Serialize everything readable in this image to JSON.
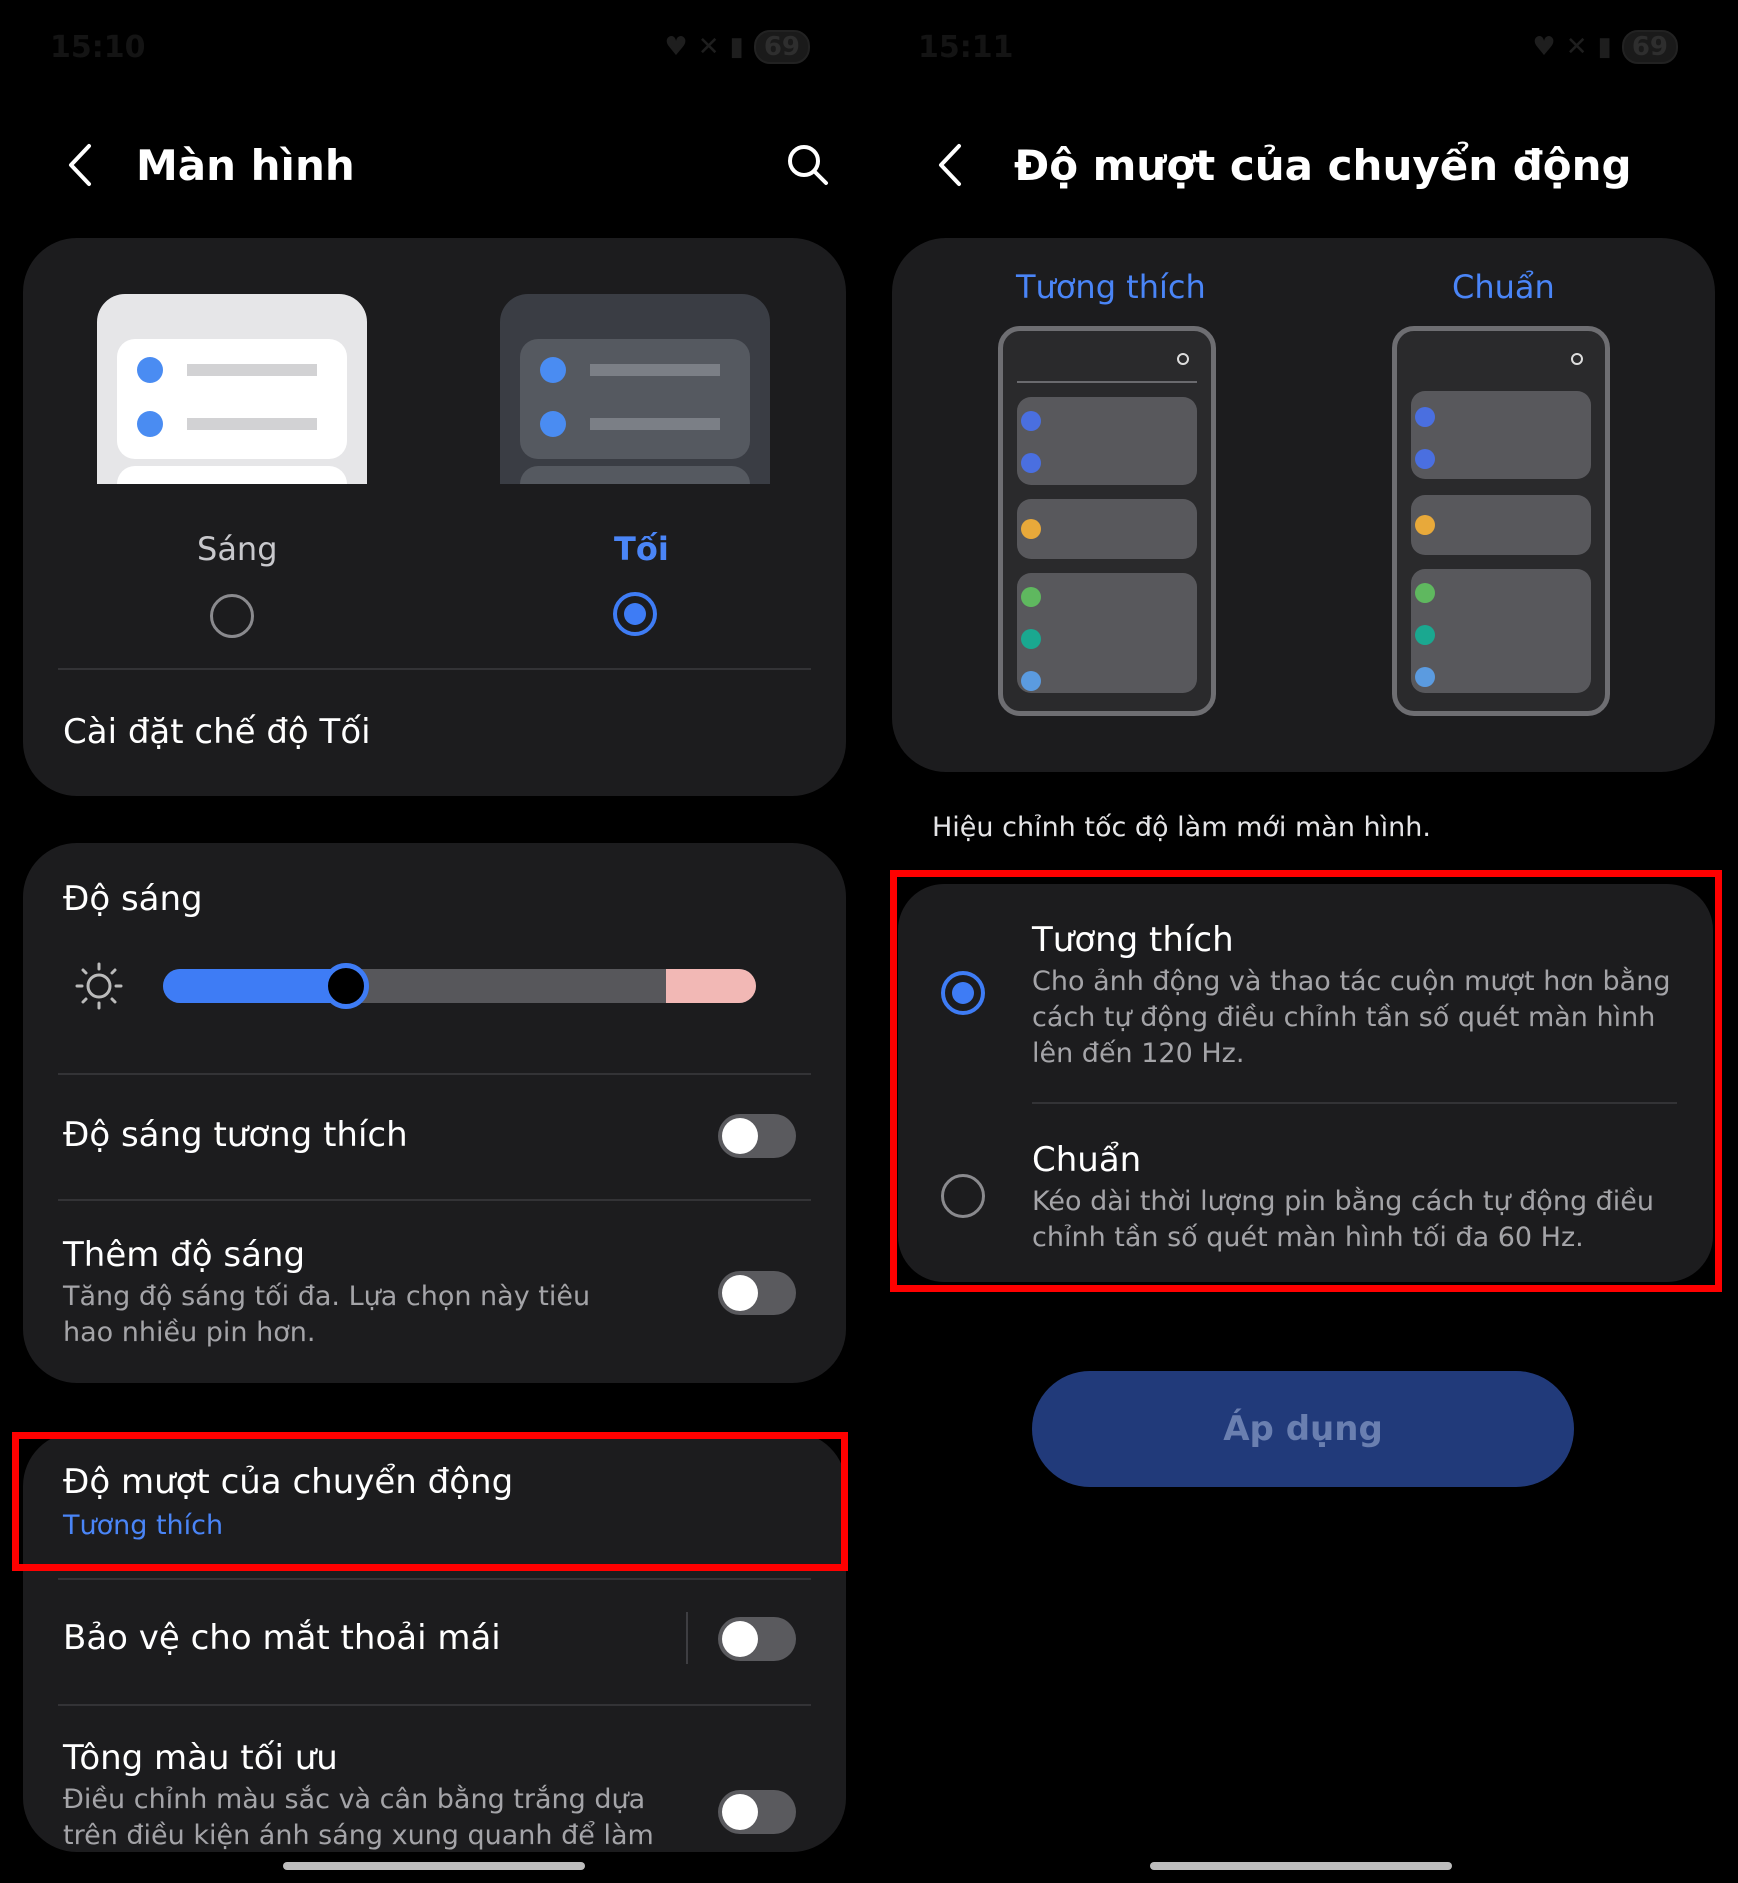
{
  "left": {
    "status": {
      "time": "15:10",
      "battery": "69"
    },
    "header": {
      "title": "Màn hình"
    },
    "theme": {
      "light_label": "Sáng",
      "dark_label": "Tối",
      "dark_mode_settings": "Cài đặt chế độ Tối"
    },
    "brightness": {
      "title": "Độ sáng",
      "level": 0.3,
      "adaptive_label": "Độ sáng tương thích",
      "extra_label": "Thêm độ sáng",
      "extra_sub": "Tăng độ sáng tối đa. Lựa chọn này tiêu hao nhiều pin hơn."
    },
    "motion": {
      "title": "Độ mượt của chuyển động",
      "value": "Tương thích"
    },
    "eye_comfort": {
      "title": "Bảo vệ cho mắt thoải mái"
    },
    "optimal_tone": {
      "title": "Tông màu tối ưu",
      "sub": "Điều chỉnh màu sắc và cân bằng trắng dựa trên điều kiện ánh sáng xung quanh để làm cho màu sắc"
    }
  },
  "right": {
    "status": {
      "time": "15:11",
      "battery": "69"
    },
    "header": {
      "title": "Độ mượt của chuyển động"
    },
    "preview": {
      "adaptive_label": "Tương thích",
      "standard_label": "Chuẩn"
    },
    "caption": "Hiệu chỉnh tốc độ làm mới màn hình.",
    "options": [
      {
        "title": "Tương thích",
        "desc": "Cho ảnh động và thao tác cuộn mượt hơn bằng cách tự động điều chỉnh tần số quét màn hình lên đến 120 Hz.",
        "selected": true
      },
      {
        "title": "Chuẩn",
        "desc": "Kéo dài thời lượng pin bằng cách tự động điều chỉnh tần số quét màn hình tối đa 60 Hz.",
        "selected": false
      }
    ],
    "apply_label": "Áp dụng"
  },
  "colors": {
    "accent": "#3e7cf5",
    "highlight_box": "#ff0000",
    "card_bg": "#1c1c1e"
  }
}
